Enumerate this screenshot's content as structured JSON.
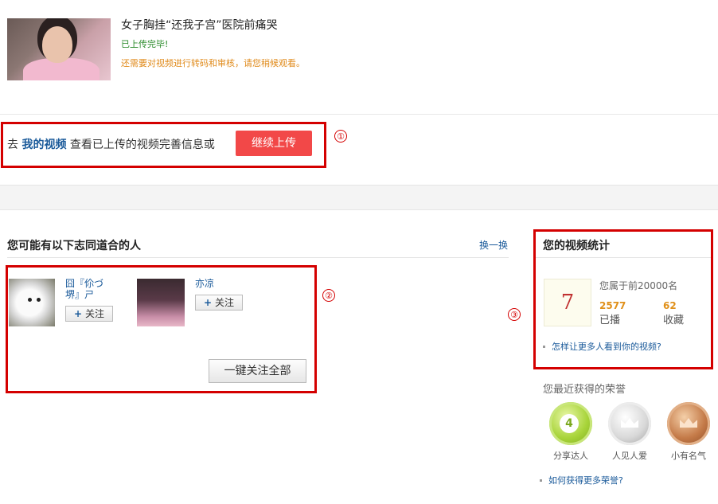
{
  "upload": {
    "video_title": "女子胸挂“还我子宫”医院前痛哭",
    "status": "已上传完毕!",
    "note": "还需要对视频进行转码和审核，请您稍候观看。"
  },
  "cta": {
    "prefix": "去 ",
    "link": "我的视频",
    "suffix": " 查看已上传的视频完善信息或",
    "continue_button": "继续上传"
  },
  "annotations": [
    "①",
    "②",
    "③"
  ],
  "recommend": {
    "title": "您可能有以下志同道合的人",
    "refresh": "换一换",
    "users": [
      {
        "name": "囧『伱づ\n堺』ㄕ",
        "follow": "关注",
        "plus": "+"
      },
      {
        "name": "亦凉",
        "follow": "关注",
        "plus": "+"
      }
    ],
    "follow_all": "一键关注全部"
  },
  "stats": {
    "title": "您的视频统计",
    "rank": "7",
    "rank_text": "您属于前20000名",
    "plays_value": "2577",
    "plays_label": "已播",
    "favs_value": "62",
    "favs_label": "收藏",
    "how_link": "怎样让更多人看到你的视频?"
  },
  "honors": {
    "title": "您最近获得的荣誉",
    "badges": [
      {
        "label": "分享达人",
        "level": "4"
      },
      {
        "label": "人见人爱"
      },
      {
        "label": "小有名气"
      }
    ],
    "how_link": "如何获得更多荣誉?"
  },
  "colors": {
    "accent_red": "#f24848",
    "annotation_red": "#d40000",
    "link_blue": "#1a5a9a",
    "orange": "#e0901a"
  }
}
